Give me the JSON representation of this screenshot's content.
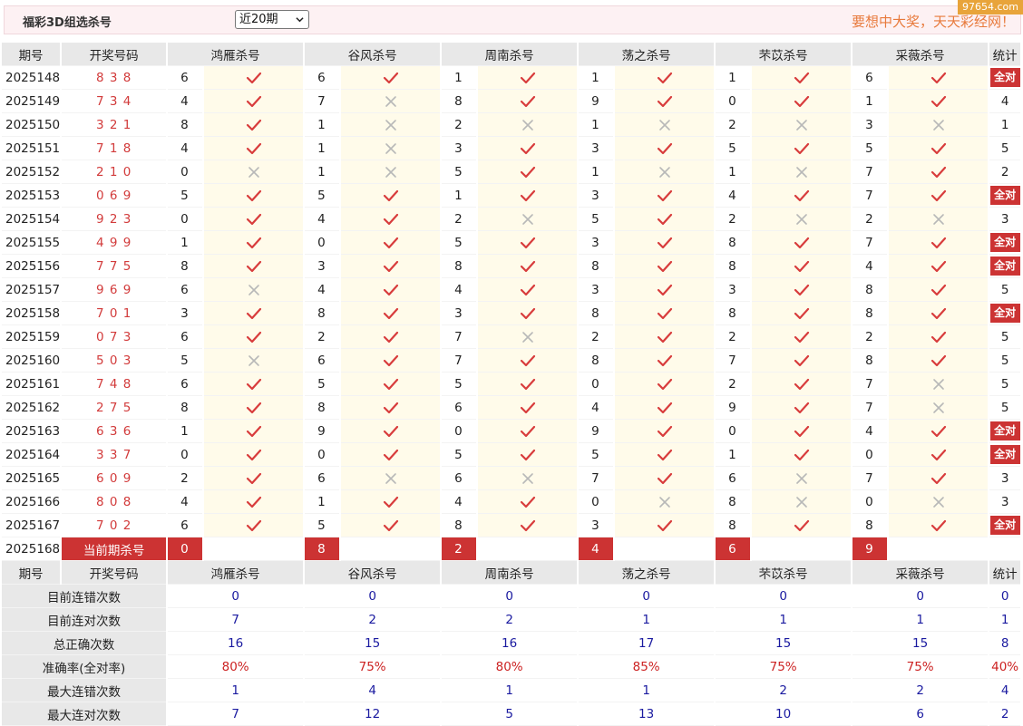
{
  "header": {
    "title": "福彩3D组选杀号",
    "period_select": "近20期",
    "slogan": "要想中大奖，天天彩经网！",
    "site_tag": "97654.com"
  },
  "columns": {
    "issue": "期号",
    "draw": "开奖号码",
    "experts": [
      "鸿雁杀号",
      "谷风杀号",
      "周南杀号",
      "荡之杀号",
      "芣苡杀号",
      "采薇杀号"
    ],
    "stat": "统计"
  },
  "all_correct_label": "全对",
  "rows": [
    {
      "issue": "2025148",
      "draw": "8 3 8",
      "kills": [
        "6",
        "6",
        "1",
        "1",
        "1",
        "6"
      ],
      "hits": [
        1,
        1,
        1,
        1,
        1,
        1
      ],
      "stat": "全对"
    },
    {
      "issue": "2025149",
      "draw": "7 3 4",
      "kills": [
        "4",
        "7",
        "8",
        "9",
        "0",
        "1"
      ],
      "hits": [
        1,
        0,
        1,
        1,
        1,
        1
      ],
      "stat": "4"
    },
    {
      "issue": "2025150",
      "draw": "3 2 1",
      "kills": [
        "8",
        "1",
        "2",
        "1",
        "2",
        "3"
      ],
      "hits": [
        1,
        0,
        0,
        0,
        0,
        0
      ],
      "stat": "1"
    },
    {
      "issue": "2025151",
      "draw": "7 1 8",
      "kills": [
        "4",
        "1",
        "3",
        "3",
        "5",
        "5"
      ],
      "hits": [
        1,
        0,
        1,
        1,
        1,
        1
      ],
      "stat": "5"
    },
    {
      "issue": "2025152",
      "draw": "2 1 0",
      "kills": [
        "0",
        "1",
        "5",
        "1",
        "1",
        "7"
      ],
      "hits": [
        0,
        0,
        1,
        0,
        0,
        1
      ],
      "stat": "2"
    },
    {
      "issue": "2025153",
      "draw": "0 6 9",
      "kills": [
        "5",
        "5",
        "1",
        "3",
        "4",
        "7"
      ],
      "hits": [
        1,
        1,
        1,
        1,
        1,
        1
      ],
      "stat": "全对"
    },
    {
      "issue": "2025154",
      "draw": "9 2 3",
      "kills": [
        "0",
        "4",
        "2",
        "5",
        "2",
        "2"
      ],
      "hits": [
        1,
        1,
        0,
        1,
        0,
        0
      ],
      "stat": "3"
    },
    {
      "issue": "2025155",
      "draw": "4 9 9",
      "kills": [
        "1",
        "0",
        "5",
        "3",
        "8",
        "7"
      ],
      "hits": [
        1,
        1,
        1,
        1,
        1,
        1
      ],
      "stat": "全对"
    },
    {
      "issue": "2025156",
      "draw": "7 7 5",
      "kills": [
        "8",
        "3",
        "8",
        "8",
        "8",
        "4"
      ],
      "hits": [
        1,
        1,
        1,
        1,
        1,
        1
      ],
      "stat": "全对"
    },
    {
      "issue": "2025157",
      "draw": "9 6 9",
      "kills": [
        "6",
        "4",
        "4",
        "3",
        "3",
        "8"
      ],
      "hits": [
        0,
        1,
        1,
        1,
        1,
        1
      ],
      "stat": "5"
    },
    {
      "issue": "2025158",
      "draw": "7 0 1",
      "kills": [
        "3",
        "8",
        "3",
        "8",
        "8",
        "8"
      ],
      "hits": [
        1,
        1,
        1,
        1,
        1,
        1
      ],
      "stat": "全对"
    },
    {
      "issue": "2025159",
      "draw": "0 7 3",
      "kills": [
        "6",
        "2",
        "7",
        "2",
        "2",
        "2"
      ],
      "hits": [
        1,
        1,
        0,
        1,
        1,
        1
      ],
      "stat": "5"
    },
    {
      "issue": "2025160",
      "draw": "5 0 3",
      "kills": [
        "5",
        "6",
        "7",
        "8",
        "7",
        "8"
      ],
      "hits": [
        0,
        1,
        1,
        1,
        1,
        1
      ],
      "stat": "5"
    },
    {
      "issue": "2025161",
      "draw": "7 4 8",
      "kills": [
        "6",
        "5",
        "5",
        "0",
        "2",
        "7"
      ],
      "hits": [
        1,
        1,
        1,
        1,
        1,
        0
      ],
      "stat": "5"
    },
    {
      "issue": "2025162",
      "draw": "2 7 5",
      "kills": [
        "8",
        "8",
        "6",
        "4",
        "9",
        "7"
      ],
      "hits": [
        1,
        1,
        1,
        1,
        1,
        0
      ],
      "stat": "5"
    },
    {
      "issue": "2025163",
      "draw": "6 3 6",
      "kills": [
        "1",
        "9",
        "0",
        "9",
        "0",
        "4"
      ],
      "hits": [
        1,
        1,
        1,
        1,
        1,
        1
      ],
      "stat": "全对"
    },
    {
      "issue": "2025164",
      "draw": "3 3 7",
      "kills": [
        "0",
        "0",
        "5",
        "5",
        "1",
        "0"
      ],
      "hits": [
        1,
        1,
        1,
        1,
        1,
        1
      ],
      "stat": "全对"
    },
    {
      "issue": "2025165",
      "draw": "6 0 9",
      "kills": [
        "2",
        "6",
        "6",
        "7",
        "6",
        "7"
      ],
      "hits": [
        1,
        0,
        0,
        1,
        0,
        1
      ],
      "stat": "3"
    },
    {
      "issue": "2025166",
      "draw": "8 0 8",
      "kills": [
        "4",
        "1",
        "4",
        "0",
        "8",
        "0"
      ],
      "hits": [
        1,
        1,
        1,
        0,
        0,
        0
      ],
      "stat": "3"
    },
    {
      "issue": "2025167",
      "draw": "7 0 2",
      "kills": [
        "6",
        "5",
        "8",
        "3",
        "8",
        "8"
      ],
      "hits": [
        1,
        1,
        1,
        1,
        1,
        1
      ],
      "stat": "全对"
    }
  ],
  "current": {
    "issue": "2025168",
    "label": "当前期杀号",
    "kills": [
      "0",
      "8",
      "2",
      "4",
      "6",
      "9"
    ]
  },
  "summary": {
    "rows": [
      {
        "label": "目前连错次数",
        "values": [
          "0",
          "0",
          "0",
          "0",
          "0",
          "0"
        ],
        "stat": "0",
        "kind": "count"
      },
      {
        "label": "目前连对次数",
        "values": [
          "7",
          "2",
          "2",
          "1",
          "1",
          "1"
        ],
        "stat": "1",
        "kind": "count"
      },
      {
        "label": "总正确次数",
        "values": [
          "16",
          "15",
          "16",
          "17",
          "15",
          "15"
        ],
        "stat": "8",
        "kind": "count"
      },
      {
        "label": "准确率(全对率)",
        "values": [
          "80%",
          "75%",
          "80%",
          "85%",
          "75%",
          "75%"
        ],
        "stat": "40%",
        "kind": "rate"
      },
      {
        "label": "最大连错次数",
        "values": [
          "1",
          "4",
          "1",
          "1",
          "2",
          "2"
        ],
        "stat": "4",
        "kind": "count"
      },
      {
        "label": "最大连对次数",
        "values": [
          "7",
          "12",
          "5",
          "13",
          "10",
          "6"
        ],
        "stat": "2",
        "kind": "count"
      }
    ]
  },
  "colors": {
    "accent_red": "#cc3333",
    "check_red": "#d83c3c",
    "cross_gray": "#b8b8b8",
    "stat_blue": "#1a1aa0"
  }
}
